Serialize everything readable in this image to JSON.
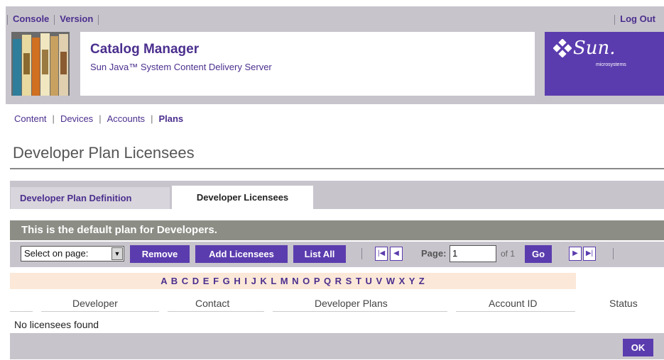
{
  "masthead": {
    "links": [
      "Console",
      "Version"
    ],
    "logout": "Log Out",
    "app_name": "Catalog Manager",
    "app_subtitle": "Sun Java™ System Content Delivery Server",
    "logo_text": "Sun.",
    "logo_sub": "microsystems"
  },
  "nav": {
    "items": [
      "Content",
      "Devices",
      "Accounts",
      "Plans"
    ],
    "active": "Plans"
  },
  "page_title": "Developer Plan Licensees",
  "tabs": [
    {
      "label": "Developer Plan Definition",
      "selected": false
    },
    {
      "label": "Developer Licensees",
      "selected": true
    }
  ],
  "banner": "This is the default plan for Developers.",
  "toolbar": {
    "select_value": "Select on page:",
    "remove": "Remove",
    "add_licensees": "Add Licensees",
    "list_all": "List All",
    "page_label": "Page:",
    "page_value": "1",
    "of_pages": "of 1",
    "go": "Go"
  },
  "alphabet": "A B C D E F G H I J K L M N O P Q R S T U V W X Y Z",
  "table": {
    "columns": [
      "Developer",
      "Contact",
      "Developer Plans",
      "Account ID",
      "Status"
    ],
    "empty_message": "No licensees found"
  },
  "footer": {
    "ok": "OK"
  },
  "colors": {
    "accent": "#5b3cae",
    "link": "#4b2f8e",
    "bar": "#c8c4cc",
    "banner": "#8c8d85",
    "alpha_bg": "#fbe8d8"
  }
}
